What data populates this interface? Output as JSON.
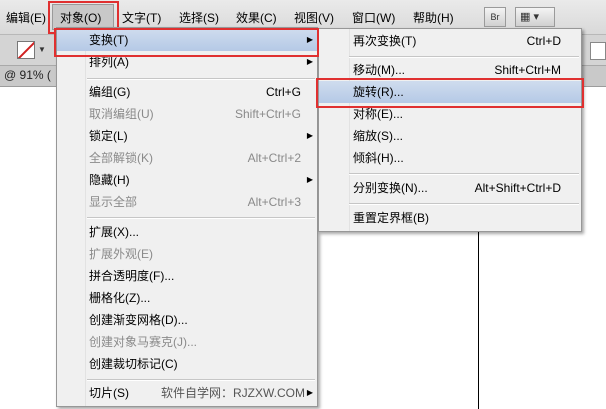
{
  "menubar": {
    "items": [
      "编辑(E)",
      "对象(O)",
      "文字(T)",
      "选择(S)",
      "效果(C)",
      "视图(V)",
      "窗口(W)",
      "帮助(H)"
    ],
    "br_label": "Br",
    "layout_glyph": "▦ ▾"
  },
  "docbar": {
    "zoom_label": "@ 91% ("
  },
  "object_menu": {
    "items": [
      {
        "label": "变换(T)",
        "shortcut": "",
        "submenu": true,
        "disabled": false,
        "selected": true
      },
      {
        "label": "排列(A)",
        "shortcut": "",
        "submenu": true,
        "disabled": false
      },
      {
        "label": "编组(G)",
        "shortcut": "Ctrl+G",
        "disabled": false
      },
      {
        "label": "取消编组(U)",
        "shortcut": "Shift+Ctrl+G",
        "disabled": true
      },
      {
        "label": "锁定(L)",
        "shortcut": "",
        "submenu": true,
        "disabled": false
      },
      {
        "label": "全部解锁(K)",
        "shortcut": "Alt+Ctrl+2",
        "disabled": true
      },
      {
        "label": "隐藏(H)",
        "shortcut": "",
        "submenu": true,
        "disabled": false
      },
      {
        "label": "显示全部",
        "shortcut": "Alt+Ctrl+3",
        "disabled": true
      },
      {
        "label": "扩展(X)...",
        "shortcut": "",
        "disabled": false
      },
      {
        "label": "扩展外观(E)",
        "shortcut": "",
        "disabled": true
      },
      {
        "label": "拼合透明度(F)...",
        "shortcut": "",
        "disabled": false
      },
      {
        "label": "栅格化(Z)...",
        "shortcut": "",
        "disabled": false
      },
      {
        "label": "创建渐变网格(D)...",
        "shortcut": "",
        "disabled": false
      },
      {
        "label": "创建对象马赛克(J)...",
        "shortcut": "",
        "disabled": true
      },
      {
        "label": "创建裁切标记(C)",
        "shortcut": "",
        "disabled": false
      },
      {
        "label": "切片(S)",
        "shortcut": "",
        "submenu": true,
        "disabled": false
      }
    ],
    "watermark": "软件自学网：RJZXW.COM"
  },
  "transform_menu": {
    "items": [
      {
        "label": "再次变换(T)",
        "shortcut": "Ctrl+D"
      },
      {
        "label": "移动(M)...",
        "shortcut": "Shift+Ctrl+M"
      },
      {
        "label": "旋转(R)...",
        "shortcut": "",
        "selected": true
      },
      {
        "label": "对称(E)...",
        "shortcut": ""
      },
      {
        "label": "缩放(S)...",
        "shortcut": ""
      },
      {
        "label": "倾斜(H)...",
        "shortcut": ""
      },
      {
        "label": "分别变换(N)...",
        "shortcut": "Alt+Shift+Ctrl+D"
      },
      {
        "label": "重置定界框(B)",
        "shortcut": ""
      }
    ]
  },
  "colors": {
    "highlight_border": "#e03030",
    "selected_bg": "#c2d3ea",
    "menu_bg": "#f0f0f0"
  }
}
